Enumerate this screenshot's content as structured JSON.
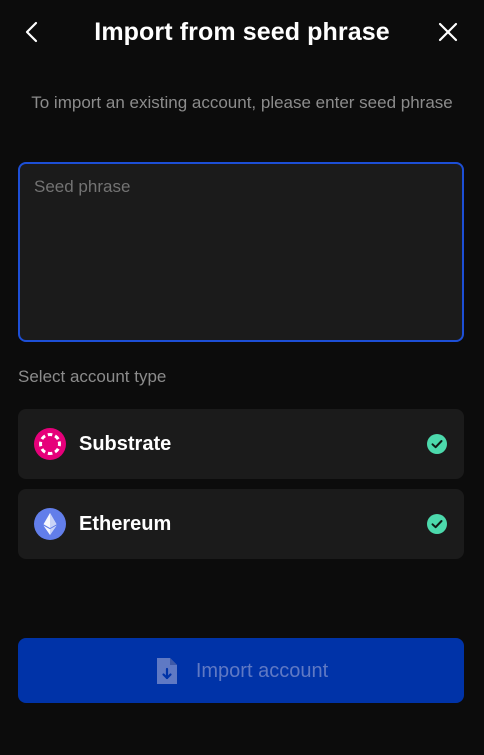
{
  "header": {
    "title": "Import from seed phrase",
    "back_icon": "chevron-left-icon",
    "close_icon": "close-icon"
  },
  "subtitle": "To import an existing account, please enter seed phrase",
  "seed_input": {
    "placeholder": "Seed phrase",
    "value": ""
  },
  "account_type": {
    "label": "Select account type",
    "options": [
      {
        "label": "Substrate",
        "icon": "polkadot-icon",
        "selected": true,
        "color": "#e6007a"
      },
      {
        "label": "Ethereum",
        "icon": "ethereum-icon",
        "selected": true,
        "color": "#627eea"
      }
    ]
  },
  "import_button": {
    "label": "Import account",
    "icon": "file-import-icon",
    "disabled": true
  },
  "colors": {
    "background": "#0c0c0c",
    "surface": "#1b1b1b",
    "accent_border": "#1d4fd6",
    "button": "#0033a8",
    "check": "#4cd9ac"
  }
}
